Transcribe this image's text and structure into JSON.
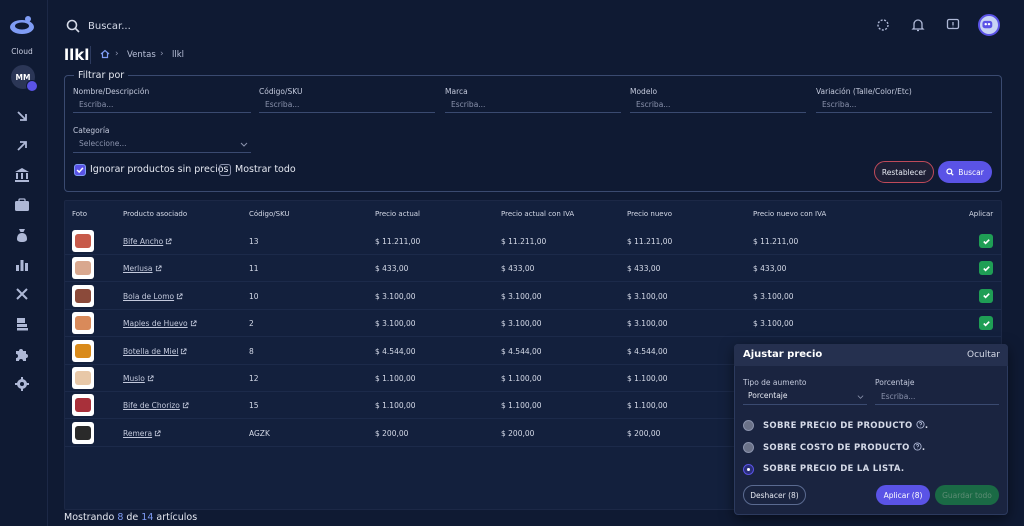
{
  "sidebar": {
    "brand_label": "Cloud",
    "user_initials": "MM",
    "icons": [
      "arrow-down-right-icon",
      "arrow-up-right-icon",
      "bank-icon",
      "briefcase-icon",
      "money-bag-icon",
      "bar-chart-icon",
      "tools-icon",
      "stack-icon",
      "puzzle-icon",
      "gear-icon"
    ]
  },
  "header": {
    "search_placeholder": "Buscar..."
  },
  "page": {
    "title": "llkl",
    "breadcrumb": [
      "Ventas",
      "llkl"
    ]
  },
  "filters": {
    "legend": "Filtrar por",
    "fields": [
      {
        "label": "Nombre/Descripción",
        "placeholder": "Escriba..."
      },
      {
        "label": "Código/SKU",
        "placeholder": "Escriba..."
      },
      {
        "label": "Marca",
        "placeholder": "Escriba..."
      },
      {
        "label": "Modelo",
        "placeholder": "Escriba..."
      },
      {
        "label": "Variación (Talle/Color/Etc)",
        "placeholder": "Escriba..."
      }
    ],
    "category_label": "Categoría",
    "category_placeholder": "Seleccione...",
    "ignore_label": "Ignorar productos sin precios",
    "ignore_checked": true,
    "show_all_label": "Mostrar todo",
    "show_all_checked": false,
    "reset_label": "Restablecer",
    "search_label": "Buscar"
  },
  "table": {
    "columns": [
      "Foto",
      "Producto asociado",
      "Código/SKU",
      "Precio actual",
      "Precio actual con IVA",
      "Precio nuevo",
      "Precio nuevo con IVA",
      "Aplicar"
    ],
    "rows": [
      {
        "product": "Bife Ancho",
        "sku": "13",
        "price": "$ 11.211,00",
        "price_iva": "$ 11.211,00",
        "new": "$ 11.211,00",
        "new_iva": "$ 11.211,00",
        "applied": true,
        "color": "#c75a4a"
      },
      {
        "product": "Merlusa",
        "sku": "11",
        "price": "$ 433,00",
        "price_iva": "$ 433,00",
        "new": "$ 433,00",
        "new_iva": "$ 433,00",
        "applied": true,
        "color": "#d9a88f"
      },
      {
        "product": "Bola de Lomo",
        "sku": "10",
        "price": "$ 3.100,00",
        "price_iva": "$ 3.100,00",
        "new": "$ 3.100,00",
        "new_iva": "$ 3.100,00",
        "applied": true,
        "color": "#8b4a3a"
      },
      {
        "product": "Maples de Huevo",
        "sku": "2",
        "price": "$ 3.100,00",
        "price_iva": "$ 3.100,00",
        "new": "$ 3.100,00",
        "new_iva": "$ 3.100,00",
        "applied": true,
        "color": "#d98a5a"
      },
      {
        "product": "Botella de Miel",
        "sku": "8",
        "price": "$ 4.544,00",
        "price_iva": "$ 4.544,00",
        "new": "$ 4.544,00",
        "new_iva": "",
        "applied": false,
        "color": "#d98a1a"
      },
      {
        "product": "Muslo",
        "sku": "12",
        "price": "$ 1.100,00",
        "price_iva": "$ 1.100,00",
        "new": "$ 1.100,00",
        "new_iva": "",
        "applied": false,
        "color": "#e8c8a8"
      },
      {
        "product": "Bife de Chorizo",
        "sku": "15",
        "price": "$ 1.100,00",
        "price_iva": "$ 1.100,00",
        "new": "$ 1.100,00",
        "new_iva": "",
        "applied": false,
        "color": "#a8303a"
      },
      {
        "product": "Remera",
        "sku": "AGZK",
        "price": "$ 200,00",
        "price_iva": "$ 200,00",
        "new": "$ 200,00",
        "new_iva": "",
        "applied": false,
        "color": "#2a2a2a"
      }
    ]
  },
  "footer": {
    "prefix": "Mostrando",
    "shown": "8",
    "middle": "de",
    "total": "14",
    "suffix": "artículos"
  },
  "adjust": {
    "title": "Ajustar precio",
    "hide_label": "Ocultar",
    "type_label": "Tipo de aumento",
    "type_value": "Porcentaje",
    "percent_label": "Porcentaje",
    "percent_placeholder": "Escriba...",
    "options": [
      {
        "label": "SOBRE PRECIO DE PRODUCTO",
        "selected": false,
        "help": true
      },
      {
        "label": "SOBRE COSTO DE PRODUCTO",
        "selected": false,
        "help": true
      },
      {
        "label": "SOBRE PRECIO DE LA LISTA.",
        "selected": true,
        "help": false
      }
    ],
    "undo_label": "Deshacer (8)",
    "apply_label": "Aplicar (8)",
    "save_all_label": "Guardar todo"
  }
}
